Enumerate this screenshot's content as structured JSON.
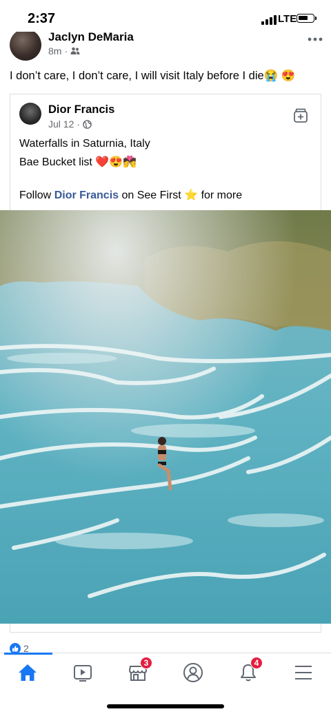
{
  "status_bar": {
    "time": "2:37",
    "network": "LTE"
  },
  "post": {
    "author": "Jaclyn DeMaria",
    "time": "8m",
    "audience_icon": "friends-icon",
    "text": "I don’t care, I don’t care, I will visit Italy before I die😭 😍"
  },
  "shared_post": {
    "author": "Dior Francis",
    "date": "Jul 12",
    "audience_icon": "globe-icon",
    "line1": "Waterfalls in Saturnia, Italy",
    "line2": "Bae Bucket list ❤️😍💏",
    "follow_prefix": "Follow ",
    "follow_link": "Dior Francis",
    "follow_suffix": " on See First ⭐ for more"
  },
  "reactions": {
    "count": "2"
  },
  "tab_bar": {
    "items": [
      {
        "name": "home",
        "icon": "home-icon",
        "active": true
      },
      {
        "name": "watch",
        "icon": "video-icon"
      },
      {
        "name": "marketplace",
        "icon": "store-icon",
        "badge": "3"
      },
      {
        "name": "profile",
        "icon": "profile-icon"
      },
      {
        "name": "notifications",
        "icon": "bell-icon",
        "badge": "4"
      },
      {
        "name": "menu",
        "icon": "menu-icon"
      }
    ]
  },
  "colors": {
    "accent": "#1877f2",
    "badge": "#e41e3f",
    "link": "#385898"
  }
}
